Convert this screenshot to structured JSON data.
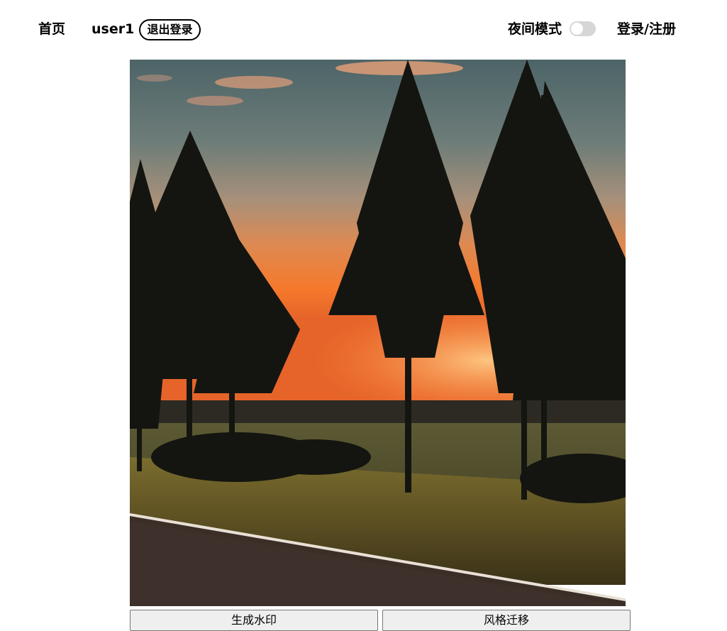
{
  "nav": {
    "home": "首页",
    "username": "user1",
    "logout": "退出登录",
    "night_mode_label": "夜间模式",
    "night_mode_on": false,
    "login_register": "登录/注册"
  },
  "actions": {
    "watermark": "生成水印",
    "style_transfer": "风格迁移"
  },
  "icons": {
    "toggle": "toggle-switch"
  }
}
